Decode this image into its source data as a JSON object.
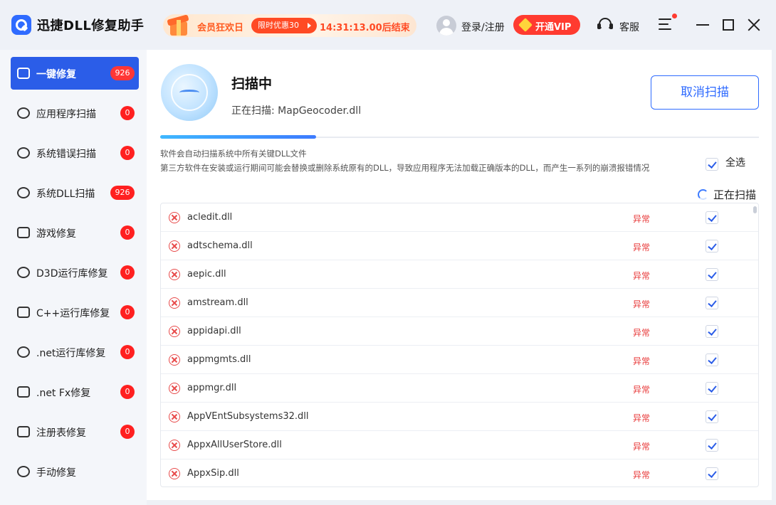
{
  "app": {
    "title": "迅捷DLL修复助手"
  },
  "promo": {
    "label": "会员狂欢日",
    "pill": "限时优惠30",
    "timer": "14:31:13.00后结束"
  },
  "header": {
    "login": "登录/注册",
    "vip": "开通VIP",
    "service": "客服"
  },
  "sidebar": {
    "items": [
      {
        "label": "一键修复",
        "badge": "926",
        "icon": "monitor-icon",
        "active": true
      },
      {
        "label": "应用程序扫描",
        "badge": "0",
        "icon": "link-icon"
      },
      {
        "label": "系统错误扫描",
        "badge": "0",
        "icon": "gear-icon"
      },
      {
        "label": "系统DLL扫描",
        "badge": "926",
        "icon": "target-icon"
      },
      {
        "label": "游戏修复",
        "badge": "0",
        "icon": "gamepad-icon"
      },
      {
        "label": "D3D运行库修复",
        "badge": "0",
        "icon": "nodes-icon"
      },
      {
        "label": "C++运行库修复",
        "badge": "0",
        "icon": "cpp-icon"
      },
      {
        "label": ".net运行库修复",
        "badge": "0",
        "icon": "planet-icon"
      },
      {
        "label": ".net Fx修复",
        "badge": "0",
        "icon": "cube-icon"
      },
      {
        "label": "注册表修复",
        "badge": "0",
        "icon": "clipboard-icon"
      },
      {
        "label": "手动修复",
        "badge": "",
        "icon": "wrench-icon"
      }
    ]
  },
  "scan": {
    "title": "扫描中",
    "current": "正在扫描: MapGeocoder.dll",
    "cancel": "取消扫描",
    "progress": 0.26,
    "info_line1": "软件会自动扫描系统中所有关键DLL文件",
    "info_line2": "第三方软件在安装或运行期间可能会替换或删除系统原有的DLL，导致应用程序无法加载正确版本的DLL，而产生一系列的崩溃报错情况",
    "select_all": "全选",
    "scanning": "正在扫描"
  },
  "files": [
    {
      "name": "acledit.dll",
      "status": "异常"
    },
    {
      "name": "adtschema.dll",
      "status": "异常"
    },
    {
      "name": "aepic.dll",
      "status": "异常"
    },
    {
      "name": "amstream.dll",
      "status": "异常"
    },
    {
      "name": "appidapi.dll",
      "status": "异常"
    },
    {
      "name": "appmgmts.dll",
      "status": "异常"
    },
    {
      "name": "appmgr.dll",
      "status": "异常"
    },
    {
      "name": "AppVEntSubsystems32.dll",
      "status": "异常"
    },
    {
      "name": "AppxAllUserStore.dll",
      "status": "异常"
    },
    {
      "name": "AppxSip.dll",
      "status": "异常"
    }
  ],
  "colors": {
    "accent": "#2b5de8",
    "badge": "#ff2020",
    "error": "#e83a3a",
    "vip": "#ff3b30",
    "promo": "#ff5a1f"
  }
}
